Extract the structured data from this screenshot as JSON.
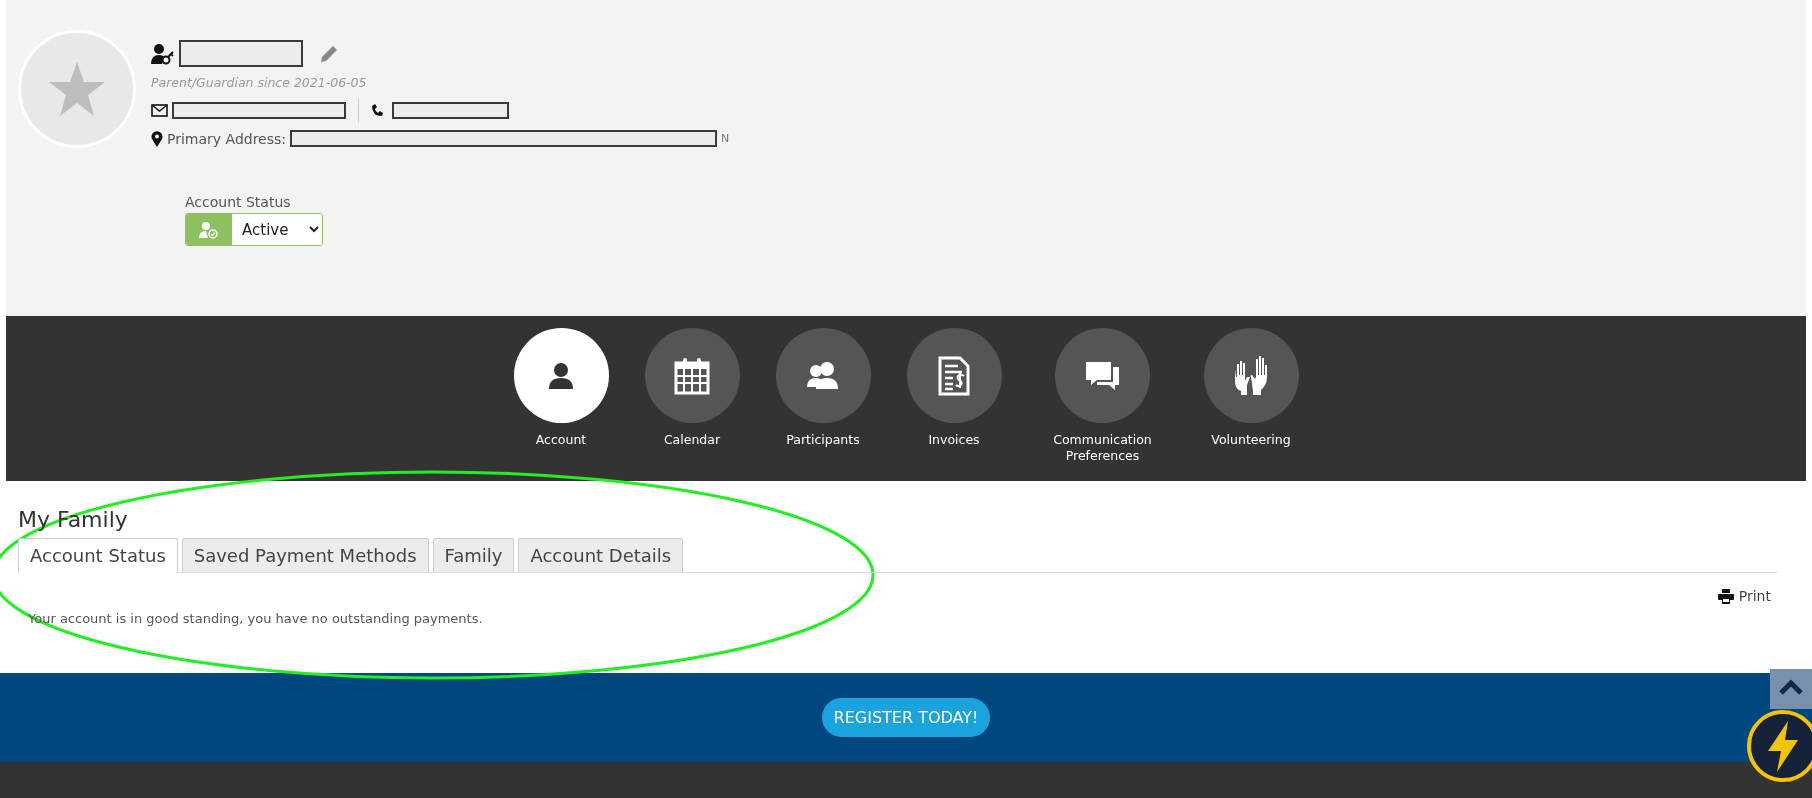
{
  "profile": {
    "subtitle": "Parent/Guardian since 2021-06-05",
    "address_label": "Primary Address:",
    "address_tail": "N"
  },
  "account_status": {
    "label": "Account Status",
    "value": "Active"
  },
  "nav": [
    {
      "label": "Account",
      "kind": "person",
      "selected": true
    },
    {
      "label": "Calendar",
      "kind": "calendar",
      "selected": false
    },
    {
      "label": "Participants",
      "kind": "people",
      "selected": false
    },
    {
      "label": "Invoices",
      "kind": "invoice",
      "selected": false
    },
    {
      "label": "Communication Preferences",
      "kind": "chat",
      "selected": false
    },
    {
      "label": "Volunteering",
      "kind": "hands",
      "selected": false
    }
  ],
  "section": {
    "title": "My Family",
    "tabs": [
      {
        "label": "Account Status",
        "selected": true
      },
      {
        "label": "Saved Payment Methods",
        "selected": false
      },
      {
        "label": "Family",
        "selected": false
      },
      {
        "label": "Account Details",
        "selected": false
      }
    ],
    "print": "Print",
    "message": "Your account is in good standing, you have no outstanding payments."
  },
  "footer": {
    "button": "REGISTER TODAY!"
  }
}
